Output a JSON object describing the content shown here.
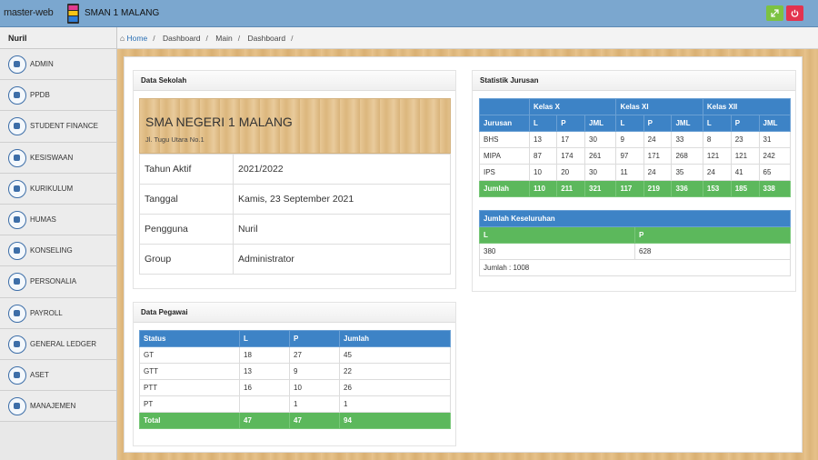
{
  "topbar": {
    "logo_text": "master-web",
    "school_title": "SMAN 1 MALANG",
    "expand_icon": "expand-icon",
    "power_icon": "power-icon"
  },
  "sidebar": {
    "user": "Nuril",
    "items": [
      {
        "label": "ADMIN",
        "icon": "admin-icon"
      },
      {
        "label": "PPDB",
        "icon": "ppdb-icon"
      },
      {
        "label": "STUDENT FINANCE",
        "icon": "finance-icon"
      },
      {
        "label": "KESISWAAN",
        "icon": "student-icon"
      },
      {
        "label": "KURIKULUM",
        "icon": "graduation-cap-icon"
      },
      {
        "label": "HUMAS",
        "icon": "support-icon"
      },
      {
        "label": "KONSELING",
        "icon": "heart-icon"
      },
      {
        "label": "PERSONALIA",
        "icon": "people-icon"
      },
      {
        "label": "PAYROLL",
        "icon": "card-icon"
      },
      {
        "label": "GENERAL LEDGER",
        "icon": "monitor-icon"
      },
      {
        "label": "ASET",
        "icon": "book-icon"
      },
      {
        "label": "MANAJEMEN",
        "icon": "building-icon"
      }
    ]
  },
  "breadcrumb": {
    "home": "Home",
    "items": [
      "Dashboard",
      "Main",
      "Dashboard"
    ]
  },
  "sekolah": {
    "title": "Data Sekolah",
    "name": "SMA NEGERI 1 MALANG",
    "address": "Jl. Tugu Utara No.1",
    "rows": [
      {
        "k": "Tahun Aktif",
        "v": "2021/2022"
      },
      {
        "k": "Tanggal",
        "v": "Kamis, 23 September 2021"
      },
      {
        "k": "Pengguna",
        "v": "Nuril"
      },
      {
        "k": "Group",
        "v": "Administrator"
      }
    ]
  },
  "pegawai": {
    "title": "Data Pegawai",
    "headers": [
      "Status",
      "L",
      "P",
      "Jumlah"
    ],
    "rows": [
      [
        "GT",
        "18",
        "27",
        "45"
      ],
      [
        "GTT",
        "13",
        "9",
        "22"
      ],
      [
        "PTT",
        "16",
        "10",
        "26"
      ],
      [
        "PT",
        "",
        "1",
        "1"
      ]
    ],
    "total": [
      "Total",
      "47",
      "47",
      "94"
    ]
  },
  "jurusan": {
    "title": "Statistik Jurusan",
    "groups": [
      "Kelas X",
      "Kelas XI",
      "Kelas XII"
    ],
    "first_col": "Jurusan",
    "sub": [
      "L",
      "P",
      "JML"
    ],
    "rows": [
      [
        "BHS",
        "13",
        "17",
        "30",
        "9",
        "24",
        "33",
        "8",
        "23",
        "31"
      ],
      [
        "MIPA",
        "87",
        "174",
        "261",
        "97",
        "171",
        "268",
        "121",
        "121",
        "242"
      ],
      [
        "IPS",
        "10",
        "20",
        "30",
        "11",
        "24",
        "35",
        "24",
        "41",
        "65"
      ]
    ],
    "total": [
      "Jumlah",
      "110",
      "211",
      "321",
      "117",
      "219",
      "336",
      "153",
      "185",
      "338"
    ]
  },
  "keseluruhan": {
    "title": "Jumlah Keseluruhan",
    "l_label": "L",
    "p_label": "P",
    "l_value": "380",
    "p_value": "628",
    "total": "Jumlah : 1008"
  }
}
